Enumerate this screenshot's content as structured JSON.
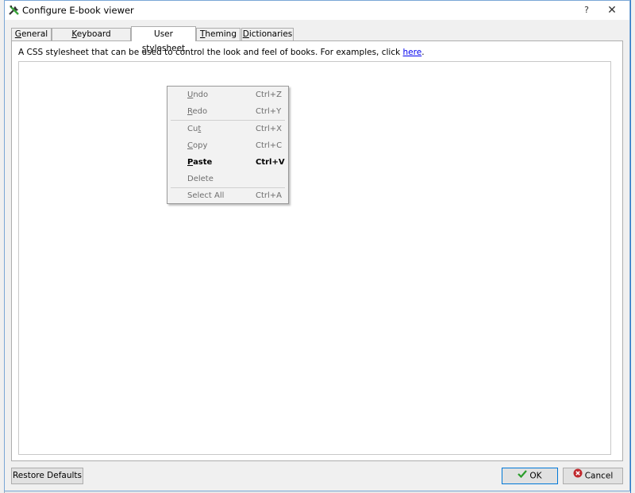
{
  "window": {
    "title": "Configure E-book viewer",
    "help_label": "?",
    "close_label": "✕"
  },
  "tabs": [
    {
      "label_pre": "",
      "label_u": "G",
      "label_post": "eneral",
      "active": false
    },
    {
      "label_pre": "",
      "label_u": "K",
      "label_post": "eyboard shortcuts",
      "active": false
    },
    {
      "label_pre": "User ",
      "label_u": "s",
      "label_post": "tylesheet",
      "active": true
    },
    {
      "label_pre": "",
      "label_u": "T",
      "label_post": "heming",
      "active": false
    },
    {
      "label_pre": "",
      "label_u": "D",
      "label_post": "ictionaries",
      "active": false
    }
  ],
  "panel": {
    "description": "A CSS stylesheet that can be used to control the look and feel of books. For examples, click ",
    "link_text": "here",
    "description_end": ".",
    "editor_value": ""
  },
  "context_menu": {
    "items": [
      {
        "pre": "",
        "u": "U",
        "post": "ndo",
        "shortcut": "Ctrl+Z",
        "enabled": false
      },
      {
        "pre": "",
        "u": "R",
        "post": "edo",
        "shortcut": "Ctrl+Y",
        "enabled": false
      },
      {
        "pre": "Cu",
        "u": "t",
        "post": "",
        "shortcut": "Ctrl+X",
        "enabled": false
      },
      {
        "pre": "",
        "u": "C",
        "post": "opy",
        "shortcut": "Ctrl+C",
        "enabled": false
      },
      {
        "pre": "",
        "u": "P",
        "post": "aste",
        "shortcut": "Ctrl+V",
        "enabled": true
      },
      {
        "pre": "Delete",
        "u": "",
        "post": "",
        "shortcut": "",
        "enabled": false
      },
      {
        "pre": "Select All",
        "u": "",
        "post": "",
        "shortcut": "Ctrl+A",
        "enabled": false
      }
    ]
  },
  "buttons": {
    "restore_defaults": "Restore Defaults",
    "ok": "OK",
    "cancel": "Cancel"
  },
  "colors": {
    "link": "#0000ee",
    "ok_check": "#2a9d2a",
    "cancel_icon": "#c0282d",
    "focus_border": "#0078d7"
  }
}
